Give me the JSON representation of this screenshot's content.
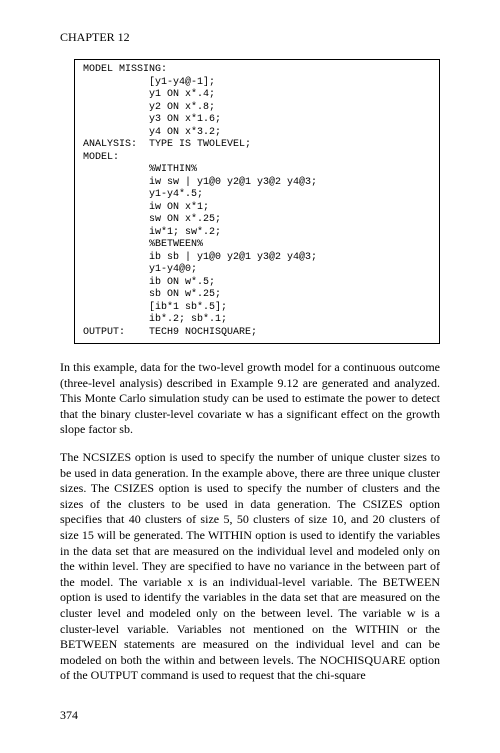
{
  "chapter": "CHAPTER 12",
  "code": "MODEL MISSING:\n           [y1-y4@-1];\n           y1 ON x*.4;\n           y2 ON x*.8;\n           y3 ON x*1.6;\n           y4 ON x*3.2;\nANALYSIS:  TYPE IS TWOLEVEL;\nMODEL:\n           %WITHIN%\n           iw sw | y1@0 y2@1 y3@2 y4@3;\n           y1-y4*.5;\n           iw ON x*1;\n           sw ON x*.25;\n           iw*1; sw*.2;\n           %BETWEEN%\n           ib sb | y1@0 y2@1 y3@2 y4@3;\n           y1-y4@0;\n           ib ON w*.5;\n           sb ON w*.25;\n           [ib*1 sb*.5];\n           ib*.2; sb*.1;\nOUTPUT:    TECH9 NOCHISQUARE;",
  "para1": "In this example, data for the two-level growth model for a continuous outcome (three-level analysis) described in Example 9.12 are generated and analyzed.  This Monte Carlo simulation study can be used to estimate the power to detect that the binary cluster-level covariate w has a significant effect on the growth slope factor sb.",
  "para2": "The NCSIZES option is used to specify the number of unique cluster sizes to be used in data generation.  In the example above, there are three unique cluster sizes.  The CSIZES option is used to specify the number of clusters and the sizes of the clusters to be used in data generation.  The CSIZES option specifies that 40 clusters of size 5, 50 clusters of size 10, and 20 clusters of size 15 will be generated.  The WITHIN option is used to identify the variables in the data set that are measured on the individual level and modeled only on the within level.  They are specified to have no variance in the between part of the model.  The variable x is an individual-level variable.  The BETWEEN option is used to identify the variables in the data set that are measured on the cluster level and modeled only on the between level.  The variable w is a cluster-level variable.  Variables not mentioned on the WITHIN or the BETWEEN statements are measured on the individual level and can be modeled on both the within and between levels.  The NOCHISQUARE option of the OUTPUT command is used to request that the chi-square",
  "pagenum": "374"
}
